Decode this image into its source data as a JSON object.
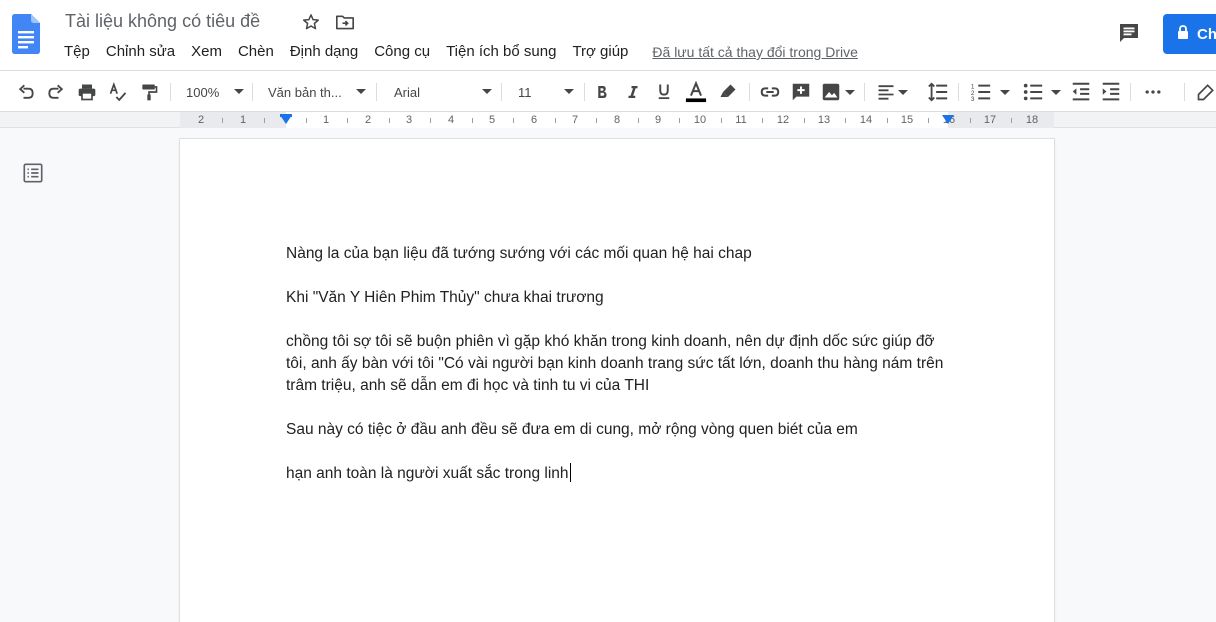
{
  "document": {
    "title": "Tài liệu không có tiêu đề",
    "save_status": "Đã lưu tất cả thay đổi trong Drive"
  },
  "menu": {
    "items": [
      "Tệp",
      "Chỉnh sửa",
      "Xem",
      "Chèn",
      "Định dạng",
      "Công cụ",
      "Tiện ích bổ sung",
      "Trợ giúp"
    ]
  },
  "header": {
    "share_label": "Ch",
    "icons": {
      "logo": "docs-logo-icon",
      "star": "star-icon",
      "move": "folder-move-icon",
      "comments": "comment-icon",
      "lock": "lock-icon"
    }
  },
  "toolbar": {
    "zoom": "100%",
    "style": "Văn bản th...",
    "font": "Arial",
    "font_size": "11",
    "icons": [
      "undo-icon",
      "redo-icon",
      "print-icon",
      "spellcheck-icon",
      "paint-format-icon",
      "bold-icon",
      "italic-icon",
      "underline-icon",
      "text-color-icon",
      "highlight-icon",
      "link-icon",
      "add-comment-icon",
      "insert-image-icon",
      "align-icon",
      "line-spacing-icon",
      "numbered-list-icon",
      "bulleted-list-icon",
      "decrease-indent-icon",
      "increase-indent-icon",
      "more-icon"
    ]
  },
  "ruler": {
    "labels": [
      "2",
      "1",
      "1",
      "2",
      "3",
      "4",
      "5",
      "6",
      "7",
      "8",
      "9",
      "10",
      "11",
      "12",
      "13",
      "14",
      "15",
      "16",
      "17",
      "18"
    ]
  },
  "content": {
    "paragraphs": [
      "Nàng la của bạn liệu đã tướng sướng với các mối quan hệ hai chap",
      "Khi \"Văn Y Hiên Phim Thủy\" chưa khai trương",
      "chồng tôi sợ tôi sẽ buộn phiên vì gặp khó khăn trong kinh doanh, nên dự định dốc sức giúp đỡ tôi, anh ấy bàn với tôi \"Có vài người bạn kinh doanh trang sức tất lớn, doanh thu hàng nám trên trâm triệu, anh sẽ dẫn em đi học và tinh tu vi của THI",
      "Sau này có tiệc ở đầu anh đều sẽ đưa em di cung, mở rộng vòng quen biét của em",
      "hạn anh toàn là người xuất sắc trong linh"
    ]
  }
}
